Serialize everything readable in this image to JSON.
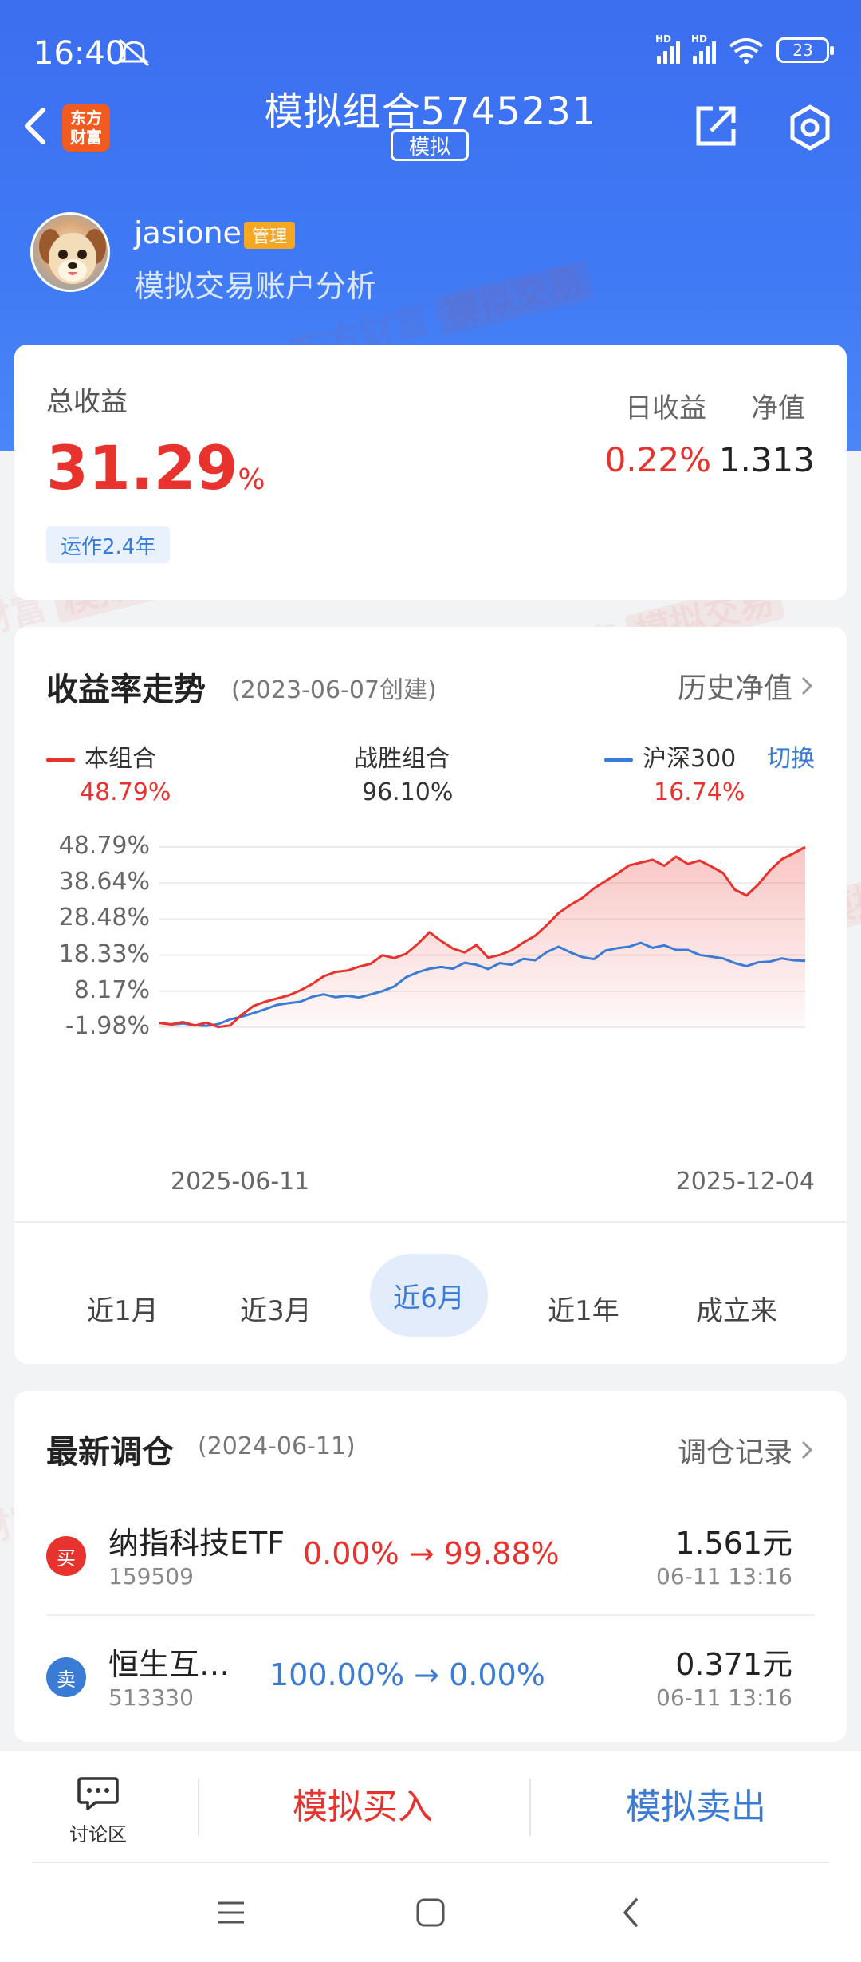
{
  "status_bar": {
    "time": "16:40",
    "battery": "23"
  },
  "nav": {
    "logo_line1": "东方",
    "logo_line2": "财富",
    "title": "模拟组合5745231",
    "badge": "模拟"
  },
  "profile": {
    "username": "jasione",
    "tag": "管理",
    "subtitle": "模拟交易账户分析"
  },
  "summary": {
    "total_label": "总收益",
    "total_value": "31.29",
    "total_unit": "%",
    "running": "运作2.4年",
    "daily_label": "日收益",
    "daily_value": "0.22%",
    "nav_label": "净值",
    "nav_value": "1.313"
  },
  "chart_section": {
    "title": "收益率走势",
    "created": "(2023-06-07创建)",
    "history_link": "历史净值",
    "switch": "切换",
    "ranges": [
      "近1月",
      "近3月",
      "近6月",
      "近1年",
      "成立来"
    ],
    "active_range": "近6月"
  },
  "chart_data": {
    "type": "area",
    "x_start": "2025-06-11",
    "x_end": "2025-12-04",
    "y_ticks": [
      "48.79%",
      "38.64%",
      "28.48%",
      "18.33%",
      "8.17%",
      "-1.98%"
    ],
    "ylim": [
      -1.98,
      48.79
    ],
    "series": [
      {
        "name": "本组合",
        "return": "48.79%",
        "color": "#e8322d",
        "values": [
          -0.8,
          -1.2,
          -0.5,
          -1.5,
          -0.7,
          -1.9,
          -1.5,
          1.5,
          4.0,
          5.2,
          6.1,
          7.0,
          8.4,
          10.2,
          12.4,
          13.6,
          14.0,
          15.1,
          15.9,
          18.3,
          17.5,
          18.7,
          21.5,
          24.8,
          22.3,
          20.2,
          19.1,
          21.2,
          17.6,
          18.4,
          19.7,
          21.9,
          23.8,
          26.8,
          30.2,
          32.5,
          34.4,
          37.1,
          39.2,
          41.3,
          43.6,
          44.4,
          45.2,
          43.5,
          46.1,
          44.0,
          45.0,
          43.3,
          41.5,
          36.8,
          35.1,
          38.2,
          42.2,
          45.3,
          47.0,
          48.8
        ]
      },
      {
        "name": "沪深300",
        "return": "16.74%",
        "color": "#3a7bd5",
        "values": [
          -0.7,
          -1.2,
          -0.9,
          -1.4,
          -1.6,
          -1.1,
          0.2,
          1.0,
          2.0,
          3.1,
          4.3,
          4.8,
          5.2,
          6.6,
          7.3,
          6.5,
          6.9,
          6.4,
          7.3,
          8.2,
          9.5,
          12.1,
          13.5,
          14.5,
          15.0,
          14.5,
          16.2,
          15.6,
          14.4,
          16.1,
          15.6,
          17.3,
          16.9,
          19.2,
          20.7,
          19.1,
          17.8,
          17.2,
          19.6,
          20.3,
          20.7,
          21.8,
          20.4,
          21.1,
          19.8,
          19.8,
          18.4,
          17.9,
          17.4,
          16.1,
          15.2,
          16.3,
          16.5,
          17.4,
          16.9,
          16.7
        ]
      }
    ],
    "win_label": "战胜组合",
    "win_value": "96.10%"
  },
  "rebalance": {
    "title": "最新调仓",
    "date": "(2024-06-11)",
    "link": "调仓记录",
    "rows": [
      {
        "type": "买",
        "name": "纳指科技ETF",
        "code": "159509",
        "from": "0.00%",
        "to": "99.88%",
        "price": "1.561元",
        "time": "06-11  13:16",
        "color": "#e8322d"
      },
      {
        "type": "卖",
        "name": "恒生互…",
        "code": "513330",
        "from": "100.00%",
        "to": "0.00%",
        "price": "0.371元",
        "time": "06-11  13:16",
        "color": "#3a7bd5"
      }
    ]
  },
  "bottom": {
    "forum": "讨论区",
    "buy": "模拟买入",
    "sell": "模拟卖出"
  },
  "watermark": {
    "brand": "东方财富",
    "tag": "模拟交易"
  }
}
